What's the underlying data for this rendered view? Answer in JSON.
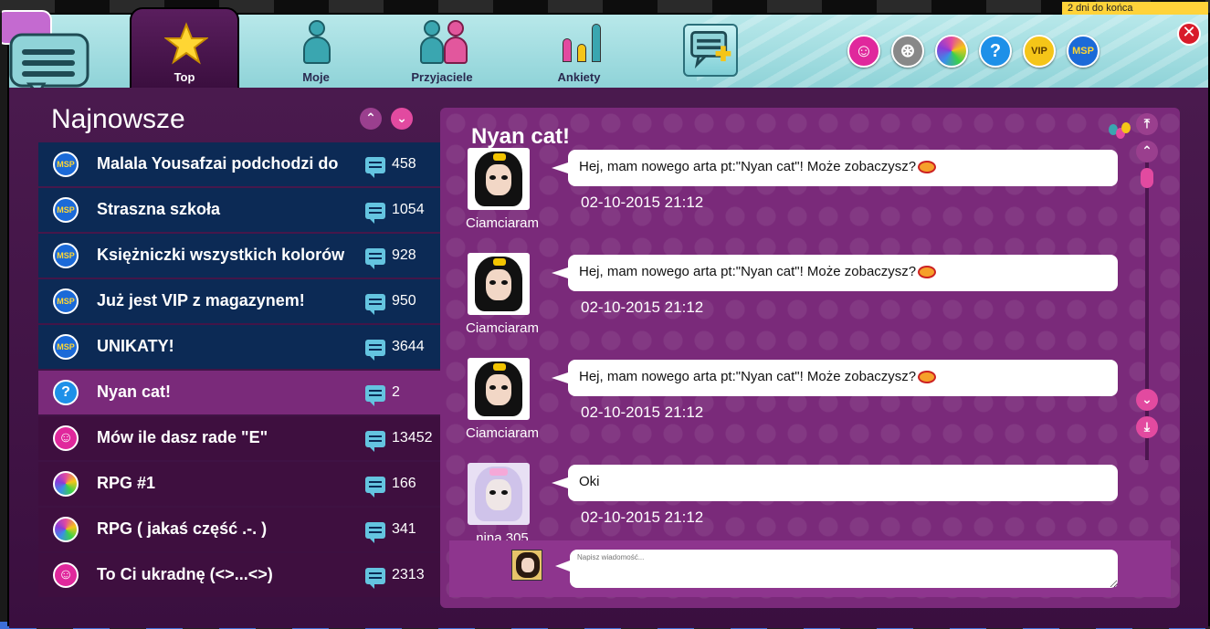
{
  "header": {
    "days_left": "2 dni do końca",
    "tabs": [
      {
        "id": "top",
        "label": "Top"
      },
      {
        "id": "moje",
        "label": "Moje"
      },
      {
        "id": "przyjaciele",
        "label": "Przyjaciele"
      },
      {
        "id": "ankiety",
        "label": "Ankiety"
      }
    ],
    "right_icons": [
      {
        "name": "smiley-icon",
        "color": "#e0289c"
      },
      {
        "name": "film-reel-icon",
        "color": "#999999"
      },
      {
        "name": "rainbow-ball-icon",
        "color": "#8a3bd8"
      },
      {
        "name": "help-icon",
        "label": "?",
        "color": "#1e90e8"
      },
      {
        "name": "vip-icon",
        "label": "VIP",
        "color": "#f5c518"
      },
      {
        "name": "msp-icon",
        "label": "MSP",
        "color": "#1b6ad8"
      }
    ],
    "close_label": "✕"
  },
  "left": {
    "title": "Najnowsze",
    "up_label": "⌃",
    "down_label": "⌄",
    "topics": [
      {
        "icon": "msp",
        "title": "Malala Yousafzai podchodzi do",
        "count": "458",
        "style": "blue"
      },
      {
        "icon": "msp",
        "title": "Straszna szkoła",
        "count": "1054",
        "style": "blue"
      },
      {
        "icon": "msp",
        "title": "Księżniczki wszystkich kolorów",
        "count": "928",
        "style": "blue"
      },
      {
        "icon": "msp",
        "title": " Już jest VIP z magazynem!",
        "count": "950",
        "style": "blue"
      },
      {
        "icon": "msp",
        "title": "UNIKATY!",
        "count": "3644",
        "style": "blue"
      },
      {
        "icon": "help",
        "title": "Nyan cat!",
        "count": "2",
        "style": "active"
      },
      {
        "icon": "smiley",
        "title": "Mów ile dasz rade \"E\"",
        "count": "13452",
        "style": "purple"
      },
      {
        "icon": "rainbow",
        "title": "RPG #1",
        "count": "166",
        "style": "purple"
      },
      {
        "icon": "rainbow",
        "title": "RPG ( jakaś część .-. )",
        "count": "341",
        "style": "purple"
      },
      {
        "icon": "smiley",
        "title": "To Ci ukradnę (<>...<>)",
        "count": "2313",
        "style": "purple"
      }
    ]
  },
  "thread": {
    "title": "Nyan cat!",
    "messages": [
      {
        "user": "Ciamciaram",
        "text": "Hej, mam nowego arta pt:\"Nyan cat\"! Może zobaczysz?",
        "emote": true,
        "time": "02-10-2015 21:12",
        "avatar": "dark"
      },
      {
        "user": "Ciamciaram",
        "text": "Hej, mam nowego arta pt:\"Nyan cat\"! Może zobaczysz?",
        "emote": true,
        "time": "02-10-2015 21:12",
        "avatar": "dark"
      },
      {
        "user": "Ciamciaram",
        "text": "Hej, mam nowego arta pt:\"Nyan cat\"! Może zobaczysz?",
        "emote": true,
        "time": "02-10-2015 21:12",
        "avatar": "dark"
      },
      {
        "user": "nina 305",
        "text": "Oki",
        "emote": false,
        "time": "02-10-2015 21:12",
        "avatar": "lilac"
      }
    ],
    "compose_placeholder": "Napisz wiadomość..."
  },
  "colors": {
    "accent_pink": "#e24aa0",
    "header_teal": "#8fd3d8",
    "panel_purple": "#7a2a7a",
    "list_blue": "#0c2a55"
  }
}
